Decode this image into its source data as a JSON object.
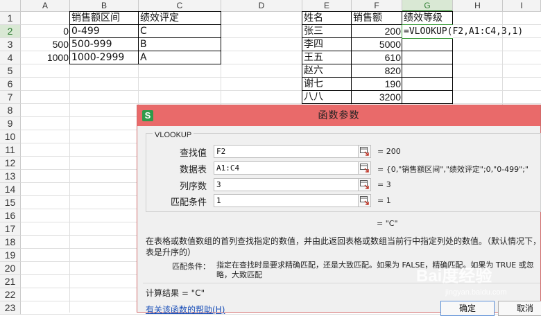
{
  "columns": [
    "A",
    "B",
    "C",
    "D",
    "E",
    "F",
    "G",
    "H",
    "I"
  ],
  "active_column": "G",
  "rows": [
    "1",
    "2",
    "3",
    "4",
    "5",
    "6",
    "7",
    "8",
    "9",
    "10",
    "11",
    "12",
    "13",
    "14",
    "15",
    "16",
    "17",
    "18",
    "19",
    "20",
    "21",
    "22",
    "23"
  ],
  "active_row": "2",
  "table1": {
    "header": [
      "",
      "销售额区间",
      "绩效评定"
    ],
    "rows": [
      [
        "0",
        "0-499",
        "C"
      ],
      [
        "500",
        "500-999",
        "B"
      ],
      [
        "1000",
        "1000-2999",
        "A"
      ]
    ]
  },
  "table2": {
    "header": [
      "姓名",
      "销售额",
      "绩效等级"
    ],
    "rows": [
      [
        "张三",
        "200"
      ],
      [
        "李四",
        "5000"
      ],
      [
        "王五",
        "610"
      ],
      [
        "赵六",
        "820"
      ],
      [
        "谢七",
        "190"
      ],
      [
        "八八",
        "3200"
      ]
    ]
  },
  "formula_cell": "=VLOOKUP(F2,A1:C4,3,1)",
  "dialog": {
    "logo": "S",
    "title": "函数参数",
    "function_name": "VLOOKUP",
    "args": [
      {
        "label": "查找值",
        "value": "F2",
        "result": "= 200"
      },
      {
        "label": "数据表",
        "value": "A1:C4",
        "result": "= {0,\"销售额区间\",\"绩效评定\";0,\"0-499\";\""
      },
      {
        "label": "列序数",
        "value": "3",
        "result": "= 3"
      },
      {
        "label": "匹配条件",
        "value": "1",
        "result": "= 1"
      }
    ],
    "result_preview": "= \"C\"",
    "description": "在表格或数值数组的首列查找指定的数值，并由此返回表格或数组当前行中指定列处的数值。（默认情况下，表是升序的）",
    "param_name": "匹配条件：",
    "param_desc": "指定在查找时是要求精确匹配，还是大致匹配。如果为 FALSE，精确匹配。如果为 TRUE 或忽略，大致匹配",
    "calc_result": "计算结果 = \"C\"",
    "help_link": "有关该函数的帮助(H)",
    "ok_label": "确定",
    "cancel_label": "取消"
  },
  "watermark": "Bai度经验",
  "watermark_sub": "jingyan.baidu.com"
}
